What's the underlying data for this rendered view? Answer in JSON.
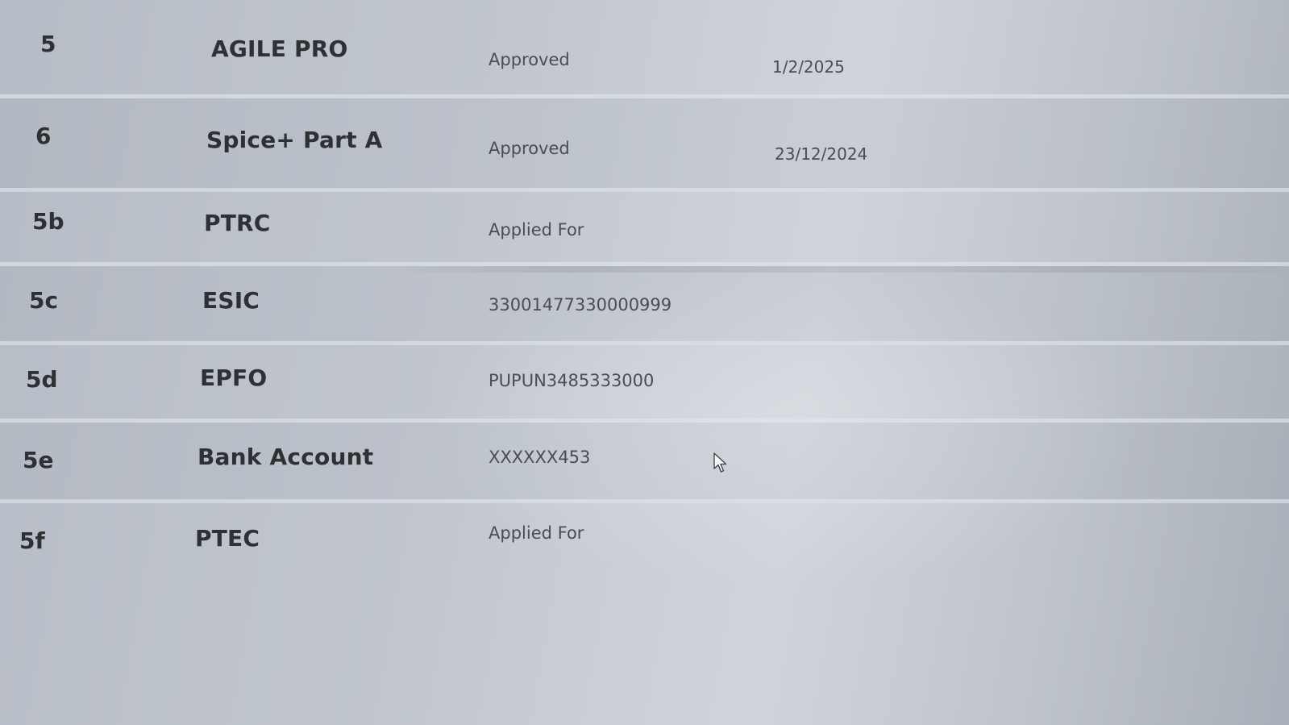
{
  "rows": [
    {
      "num": "5",
      "name": "AGILE PRO",
      "status": "Approved",
      "date": "1/2/2025"
    },
    {
      "num": "6",
      "name": "Spice+ Part A",
      "status": "Approved",
      "date": "23/12/2024"
    },
    {
      "num": "5b",
      "name": "PTRC",
      "status": "Applied For",
      "date": ""
    },
    {
      "num": "5c",
      "name": "ESIC",
      "status": "33001477330000999",
      "date": ""
    },
    {
      "num": "5d",
      "name": "EPFO",
      "status": "PUPUN3485333000",
      "date": ""
    },
    {
      "num": "5e",
      "name": "Bank Account",
      "status": "XXXXXX453",
      "date": ""
    },
    {
      "num": "5f",
      "name": "PTEC",
      "status": "Applied For",
      "date": ""
    }
  ],
  "icons": {
    "cursor": "mouse-pointer-icon"
  },
  "colors": {
    "text_bold": "#2e3034",
    "text_regular": "#4a4d52",
    "background": "#c1c6ce"
  }
}
